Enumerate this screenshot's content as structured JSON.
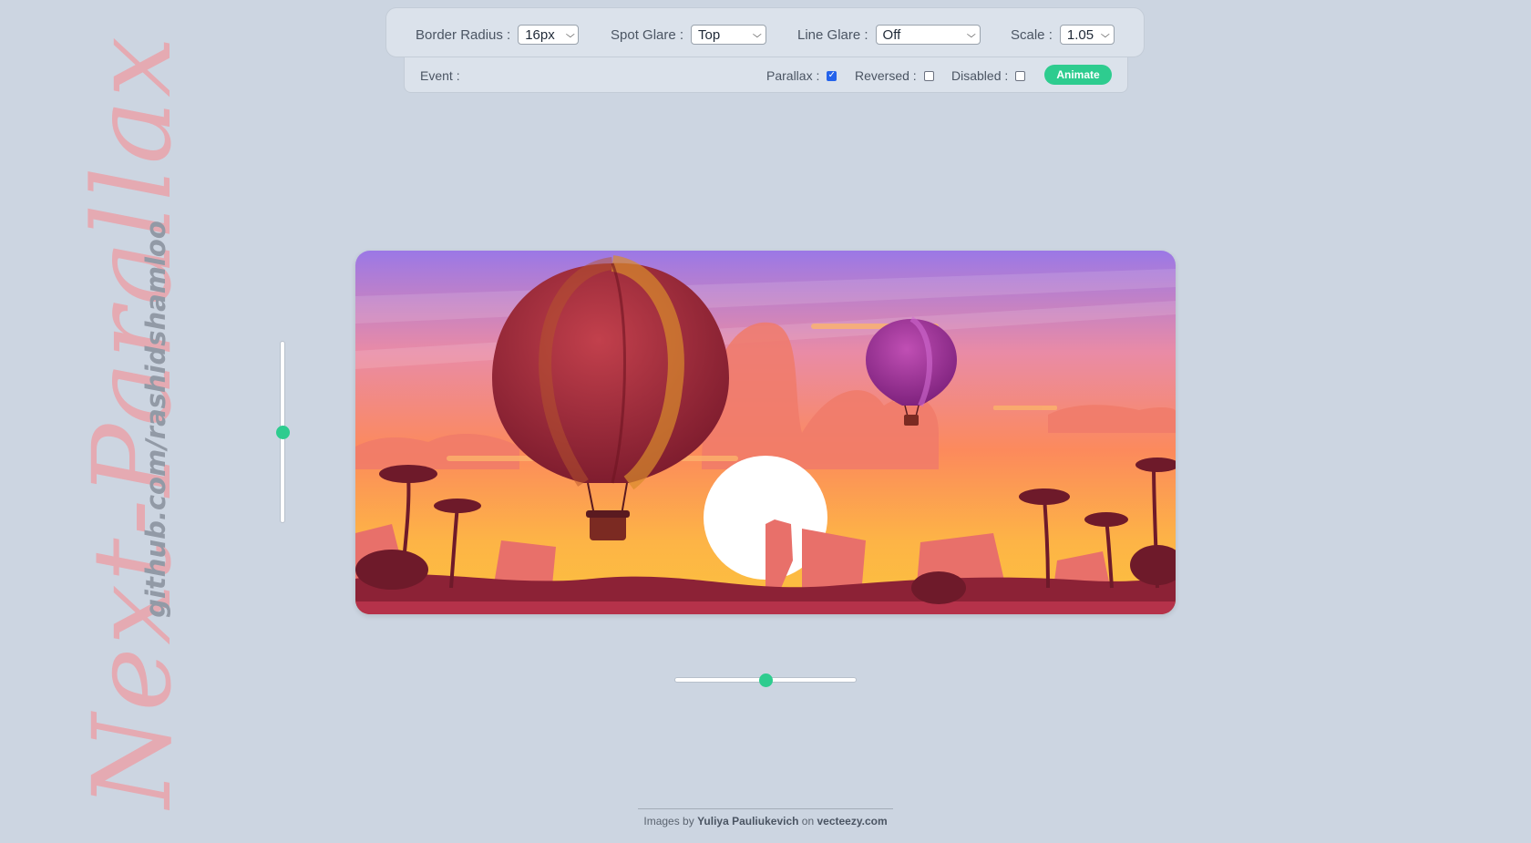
{
  "brand": {
    "script_title": "Next-Parallax",
    "repo": "github.com/rashidshamloo"
  },
  "toolbar": {
    "border_radius": {
      "label": "Border Radius :",
      "value": "16px"
    },
    "spot_glare": {
      "label": "Spot Glare :",
      "value": "Top"
    },
    "line_glare": {
      "label": "Line Glare :",
      "value": "Off"
    },
    "scale": {
      "label": "Scale :",
      "value": "1.05"
    }
  },
  "subbar": {
    "event_label": "Event :",
    "parallax_label": "Parallax :",
    "parallax_checked": true,
    "reversed_label": "Reversed :",
    "reversed_checked": false,
    "disabled_label": "Disabled :",
    "disabled_checked": false,
    "animate_label": "Animate"
  },
  "sliders": {
    "vertical_value": 0.5,
    "horizontal_value": 0.5
  },
  "image": {
    "icon": "hot-air-balloon-sunset-illustration"
  },
  "footer": {
    "prefix": "Images by",
    "author": "Yuliya Pauliukevich",
    "middle": "on",
    "site": "vecteezy.com"
  },
  "colors": {
    "accent": "#2ecc8f",
    "background": "#ccd5e1",
    "checkbox": "#2563eb"
  }
}
